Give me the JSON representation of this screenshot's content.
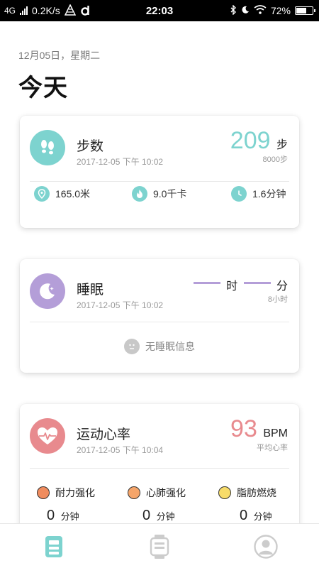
{
  "status_bar": {
    "network": "4G",
    "speed": "0.2K/s",
    "time": "22:03",
    "battery": "72%",
    "battery_level": 0.72
  },
  "header": {
    "date": "12月05日，星期二",
    "title": "今天"
  },
  "steps_card": {
    "icon": "footprints-icon",
    "title": "步数",
    "time": "2017-12-05 下午 10:02",
    "value": "209",
    "unit": "步",
    "goal": "8000步",
    "accent": "#7dd3cf",
    "metrics": [
      {
        "icon": "location-pin-icon",
        "text": "165.0米"
      },
      {
        "icon": "flame-icon",
        "text": "9.0千卡"
      },
      {
        "icon": "clock-icon",
        "text": "1.6分钟"
      }
    ]
  },
  "sleep_card": {
    "icon": "moon-icon",
    "title": "睡眠",
    "time": "2017-12-05 下午 10:02",
    "hours_unit": "时",
    "minutes_unit": "分",
    "goal": "8小时",
    "accent": "#b49ed8",
    "empty_text": "无睡眠信息"
  },
  "heart_card": {
    "icon": "heart-pulse-icon",
    "title": "运动心率",
    "time": "2017-12-05 下午 10:04",
    "value": "93",
    "unit": "BPM",
    "label": "平均心率",
    "accent": "#e88a8e",
    "zones": [
      {
        "name": "耐力强化",
        "value": "0",
        "unit": "分钟",
        "color": "#f08c5e"
      },
      {
        "name": "心肺强化",
        "value": "0",
        "unit": "分钟",
        "color": "#f5a56a"
      },
      {
        "name": "脂肪燃烧",
        "value": "0",
        "unit": "分钟",
        "color": "#f7dc6a"
      }
    ]
  },
  "tab_bar": {
    "tabs": [
      {
        "icon": "today-icon",
        "active": true
      },
      {
        "icon": "watch-icon",
        "active": false
      },
      {
        "icon": "profile-icon",
        "active": false
      }
    ],
    "active_color": "#7dd3cf",
    "inactive_color": "#cccccc"
  }
}
